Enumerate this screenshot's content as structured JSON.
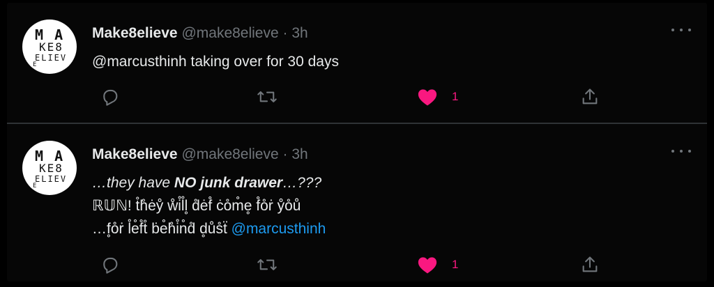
{
  "tweets": [
    {
      "avatar_letters": [
        "M A",
        "KE8",
        "ELIEV",
        "E"
      ],
      "name": "Make8elieve",
      "handle": "@make8elieve",
      "separator": "·",
      "time": "3h",
      "text_lines": [
        "@marcusthinh taking over for 30 days"
      ],
      "like_count": "1"
    },
    {
      "avatar_letters": [
        "M A",
        "KE8",
        "ELIEV",
        "E"
      ],
      "name": "Make8elieve",
      "handle": "@make8elieve",
      "separator": "·",
      "time": "3h",
      "line1_italic": "…they have ",
      "line1_bold": "NO junk drawer",
      "line1_end": "…???",
      "line2": "ℝ𝕌ℕ! t̊h̊ėẙ ẘi̊l̊l̥ d̊ėf̊ ċo̊m̊e̥ f̊o̊ṙ ẙo̊ů",
      "line3_text": "…f̥o̊ṙ l̊e̊f̊t̊ ḃe̊h̊i̊n̊d̊ d̥ůs̊ẗ ",
      "line3_link": "@marcusthinh",
      "like_count": "1"
    }
  ],
  "colors": {
    "background": "#000000",
    "card": "#060606",
    "text": "#e7e9ea",
    "secondary": "#71767b",
    "like": "#f91880",
    "link": "#1d9bf0",
    "divider": "#2f3336"
  },
  "icons": {
    "reply": "reply-icon",
    "retweet": "retweet-icon",
    "like": "heart-icon",
    "share": "share-icon",
    "more": "more-icon"
  }
}
